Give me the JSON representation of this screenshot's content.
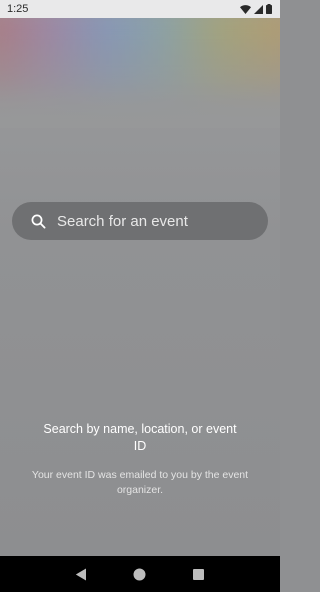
{
  "status_bar": {
    "time": "1:25",
    "icons": [
      "wifi-icon",
      "cellular-signal-icon",
      "battery-icon"
    ]
  },
  "search": {
    "placeholder": "Search for an event",
    "icon": "search-icon"
  },
  "help": {
    "title": "Search by name, location, or event ID",
    "subtitle": "Your event ID was emailed to you by the event organizer."
  },
  "nav_bar": {
    "buttons": [
      "back-icon",
      "home-icon",
      "recents-icon"
    ]
  },
  "colors": {
    "background": "#8f9092",
    "search_bar": "#6f7072",
    "nav_bar": "#000000",
    "status_bar": "#e9e9ea"
  }
}
